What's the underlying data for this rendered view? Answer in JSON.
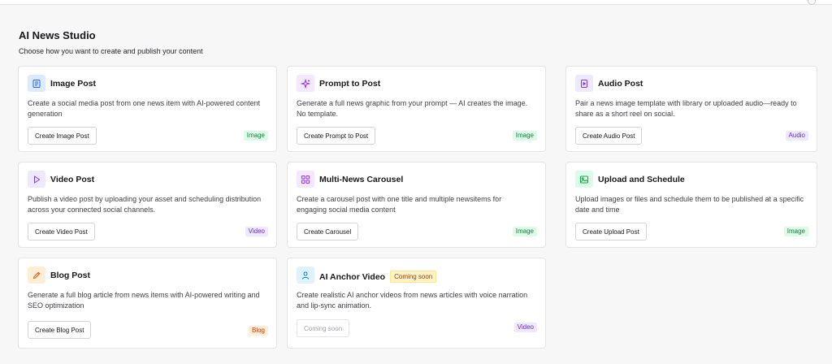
{
  "page": {
    "title": "AI News Studio",
    "subtitle": "Choose how you want to create and publish your content"
  },
  "cards": [
    {
      "title": "Image Post",
      "description": "Create a social media post from one news item with AI-powered content generation",
      "button": "Create Image Post",
      "tag": "Image",
      "icon": "document-icon",
      "icon_bg": "#dbeafe",
      "icon_color": "#2563eb"
    },
    {
      "title": "Prompt to Post",
      "description": "Generate a full news graphic from your prompt — AI creates the image. No template.",
      "button": "Create Prompt to Post",
      "tag": "Image",
      "icon": "sparkle-icon",
      "icon_bg": "#f3e8ff",
      "icon_color": "#9333ea"
    },
    {
      "title": "Audio Post",
      "description": "Pair a news image template with library or uploaded audio—ready to share as a short reel on social.",
      "button": "Create Audio Post",
      "tag": "Audio",
      "icon": "play-file-icon",
      "icon_bg": "#ede9fe",
      "icon_color": "#7c3aed"
    },
    {
      "title": "Video Post",
      "description": "Publish a video post by uploading your asset and scheduling distribution across your connected social channels.",
      "button": "Create Video Post",
      "tag": "Video",
      "icon": "play-icon",
      "icon_bg": "#ede9fe",
      "icon_color": "#7c3aed"
    },
    {
      "title": "Multi-News Carousel",
      "description": "Create a carousel post with one title and multiple newsitems for engaging social media content",
      "button": "Create Carousel",
      "tag": "Image",
      "icon": "grid-icon",
      "icon_bg": "#f3e8ff",
      "icon_color": "#9333ea"
    },
    {
      "title": "Upload and Schedule",
      "description": "Upload images or files and schedule them to be published at a specific date and time",
      "button": "Create Upload Post",
      "tag": "Image",
      "icon": "image-icon",
      "icon_bg": "#dcfce7",
      "icon_color": "#16a34a"
    },
    {
      "title": "Blog Post",
      "description": "Generate a full blog article from news items with AI-powered writing and SEO optimization",
      "button": "Create Blog Post",
      "tag": "Blog",
      "icon": "pencil-icon",
      "icon_bg": "#ffedd5",
      "icon_color": "#ea580c"
    },
    {
      "title": "AI Anchor Video",
      "badge": "Coming soon",
      "description": "Create realistic AI anchor videos from news articles with voice narration and lip-sync animation.",
      "button": "Coming soon",
      "tag": "Video",
      "icon": "user-icon",
      "icon_bg": "#e0f2fe",
      "icon_color": "#0284c7"
    }
  ]
}
